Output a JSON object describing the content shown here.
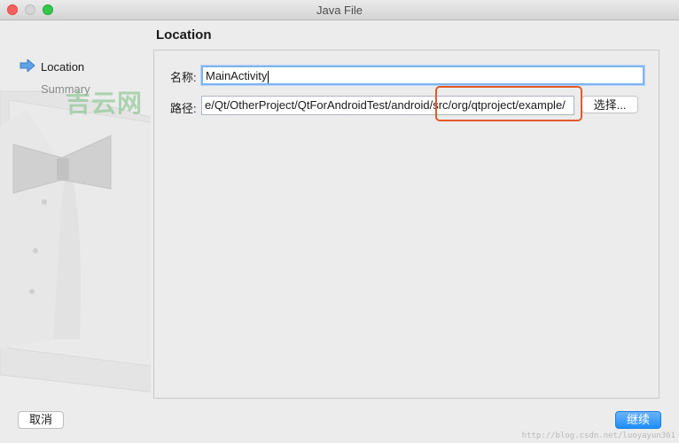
{
  "window": {
    "title": "Java File"
  },
  "sidebar": {
    "steps": [
      {
        "label": "Location",
        "active": true
      },
      {
        "label": "Summary",
        "active": false
      }
    ],
    "watermark": "吉云网"
  },
  "page": {
    "title": "Location"
  },
  "form": {
    "name_label": "名称:",
    "name_value": "MainActivity",
    "path_label": "路径:",
    "path_value": "e/Qt/OtherProject/QtForAndroidTest/android/src/org/qtproject/example/",
    "browse_label": "选择..."
  },
  "buttons": {
    "cancel_label": "取消",
    "continue_label": "继续"
  },
  "footer": {
    "url": "http://blog.csdn.net/luoyayun361"
  },
  "colors": {
    "accent": "#1f8efa",
    "highlight": "#e35a2a",
    "focus_ring": "#7db5f2"
  }
}
